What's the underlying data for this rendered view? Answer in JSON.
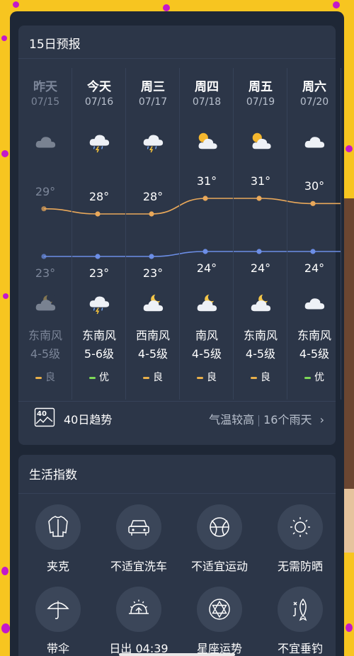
{
  "forecast": {
    "title": "15日预报",
    "days": [
      {
        "day": "昨天",
        "date": "07/15",
        "hi": "29°",
        "lo": "23°",
        "icon_top": "cloudy-icon",
        "icon_bottom": "cloudy-night-icon",
        "wind_dir": "东南风",
        "wind_level": "4-5级",
        "aq": "良",
        "aq_color": "#e9b04a",
        "past": true
      },
      {
        "day": "今天",
        "date": "07/16",
        "hi": "28°",
        "lo": "23°",
        "icon_top": "thunderstorm-icon",
        "icon_bottom": "thunderstorm-icon",
        "wind_dir": "东南风",
        "wind_level": "5-6级",
        "aq": "优",
        "aq_color": "#7ed957",
        "past": false
      },
      {
        "day": "周三",
        "date": "07/17",
        "hi": "28°",
        "lo": "23°",
        "icon_top": "thunderstorm-icon",
        "icon_bottom": "partly-cloudy-night-icon",
        "wind_dir": "西南风",
        "wind_level": "4-5级",
        "aq": "良",
        "aq_color": "#e9b04a",
        "past": false
      },
      {
        "day": "周四",
        "date": "07/18",
        "hi": "31°",
        "lo": "24°",
        "icon_top": "partly-cloudy-day-icon",
        "icon_bottom": "partly-cloudy-night-icon",
        "wind_dir": "南风",
        "wind_level": "4-5级",
        "aq": "良",
        "aq_color": "#e9b04a",
        "past": false
      },
      {
        "day": "周五",
        "date": "07/19",
        "hi": "31°",
        "lo": "24°",
        "icon_top": "partly-cloudy-day-icon",
        "icon_bottom": "partly-cloudy-night-icon",
        "wind_dir": "东南风",
        "wind_level": "4-5级",
        "aq": "良",
        "aq_color": "#e9b04a",
        "past": false
      },
      {
        "day": "周六",
        "date": "07/20",
        "hi": "30°",
        "lo": "24°",
        "icon_top": "cloud-icon",
        "icon_bottom": "cloud-icon",
        "wind_dir": "东南风",
        "wind_level": "4-5级",
        "aq": "优",
        "aq_color": "#7ed957",
        "past": false
      }
    ],
    "high_temps": [
      29,
      28,
      28,
      31,
      31,
      30,
      30
    ],
    "low_temps": [
      23,
      23,
      23,
      24,
      24,
      24,
      24
    ],
    "high_line_color": "#e9a85a",
    "low_line_color": "#6c8ee6",
    "trend_label": "40日趋势",
    "trend_icon_text": "40",
    "trend_summary_1": "气温较高",
    "trend_summary_2": "16个雨天"
  },
  "life_index": {
    "title": "生活指数",
    "items": [
      {
        "label": "夹克",
        "icon": "jacket-icon"
      },
      {
        "label": "不适宜洗车",
        "icon": "car-icon"
      },
      {
        "label": "不适宜运动",
        "icon": "basketball-icon"
      },
      {
        "label": "无需防晒",
        "icon": "sun-icon"
      },
      {
        "label": "带伞",
        "icon": "umbrella-icon"
      },
      {
        "label": "日出 04:39",
        "icon": "sunrise-icon"
      },
      {
        "label": "星座运势",
        "icon": "star-of-david-icon"
      },
      {
        "label": "不宜垂钓",
        "icon": "fishing-icon"
      }
    ]
  }
}
